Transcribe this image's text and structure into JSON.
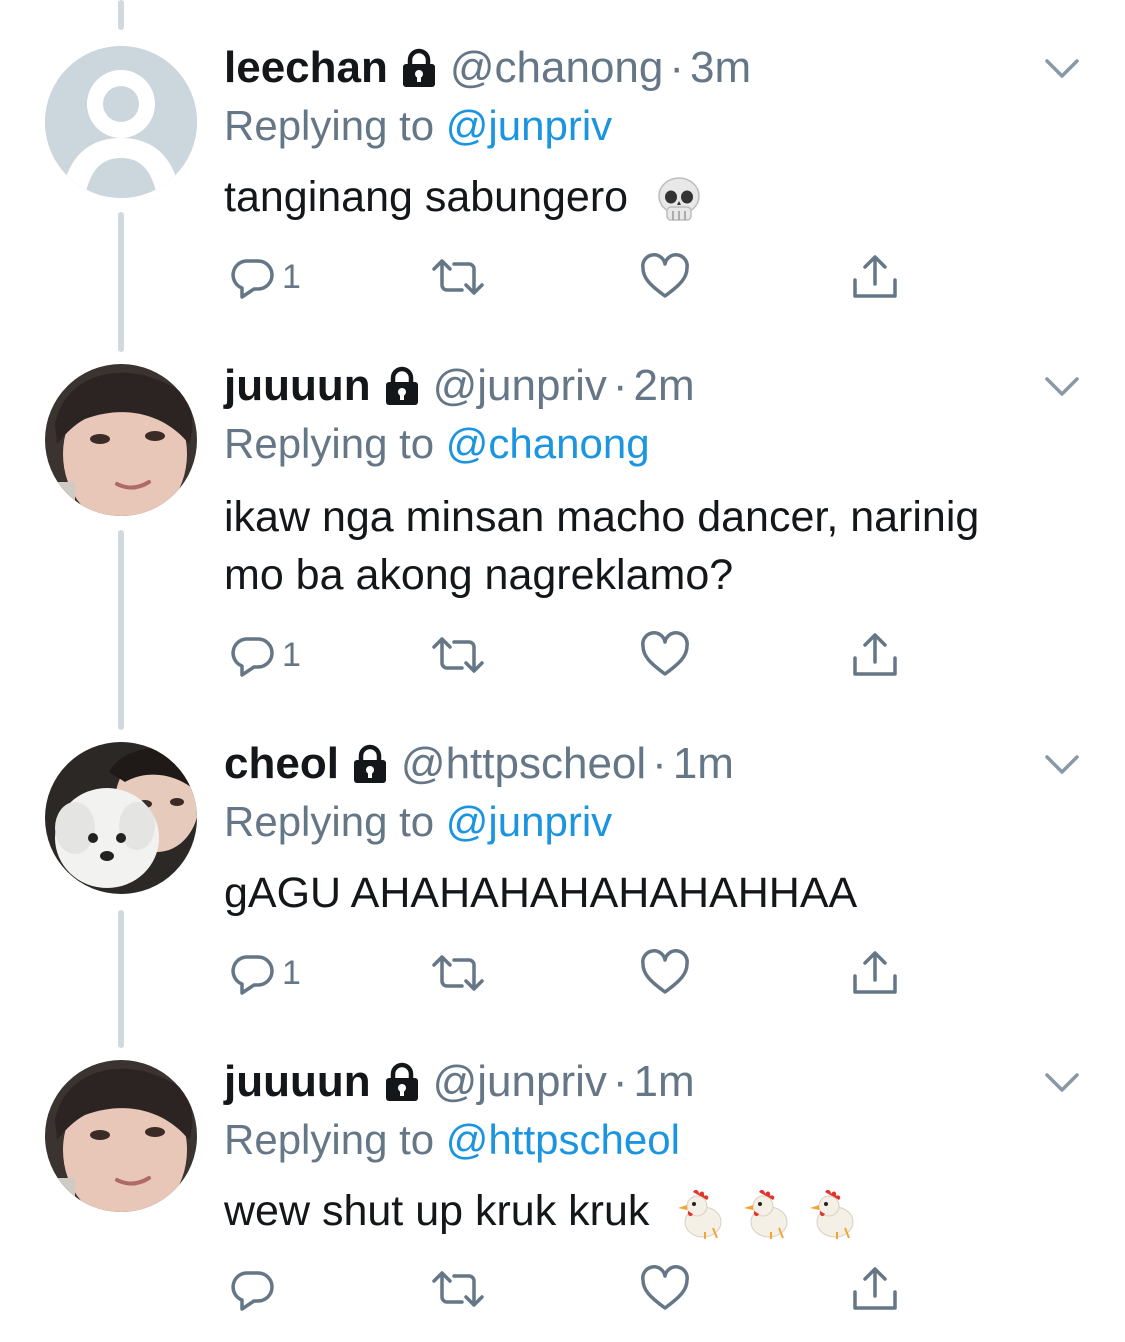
{
  "tweets": [
    {
      "display_name": "leechan",
      "handle": "@chanong",
      "separator": "·",
      "time": "3m",
      "replying_prefix": "Replying to",
      "replying_to": "@junpriv",
      "text": "tanginang sabungero",
      "emoji": [
        "skull-emoji"
      ],
      "reply_count": "1",
      "avatar": "default-avatar"
    },
    {
      "display_name": "juuuun",
      "handle": "@junpriv",
      "separator": "·",
      "time": "2m",
      "replying_prefix": "Replying to",
      "replying_to": "@chanong",
      "text_line1": "ikaw nga minsan macho dancer, narinig",
      "text_line2": "mo ba akong nagreklamo?",
      "emoji": [],
      "reply_count": "1",
      "avatar": "user-photo-avatar"
    },
    {
      "display_name": "cheol",
      "handle": "@httpscheol",
      "separator": "·",
      "time": "1m",
      "replying_prefix": "Replying to",
      "replying_to": "@junpriv",
      "text": "gAGU AHAHAHAHAHAHAHHAA",
      "emoji": [],
      "reply_count": "1",
      "avatar": "user-with-dog-avatar"
    },
    {
      "display_name": "juuuun",
      "handle": "@junpriv",
      "separator": "·",
      "time": "1m",
      "replying_prefix": "Replying to",
      "replying_to": "@httpscheol",
      "text": "wew shut up kruk kruk",
      "emoji": [
        "rooster-emoji",
        "rooster-emoji",
        "rooster-emoji"
      ],
      "reply_count": "",
      "avatar": "user-photo-avatar"
    }
  ],
  "icons": {
    "lock": "lock-icon",
    "chevron": "chevron-down-icon",
    "reply": "reply-icon",
    "retweet": "retweet-icon",
    "like": "heart-icon",
    "share": "share-icon"
  },
  "colors": {
    "text": "#14171a",
    "secondary": "#657786",
    "link": "#1b95e0",
    "thread_line": "#cfd9de"
  }
}
